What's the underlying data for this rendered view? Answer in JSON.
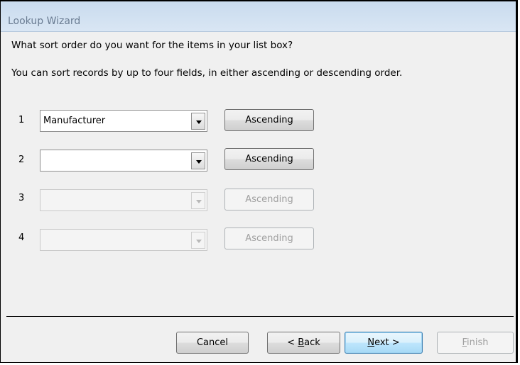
{
  "window": {
    "title": "Lookup Wizard"
  },
  "prompt": {
    "question": "What sort order do you want for the items in your list box?",
    "instructions": "You can sort records by up to four fields, in either ascending or descending order."
  },
  "sort_rows": [
    {
      "number": "1",
      "field": "Manufacturer",
      "order": "Ascending",
      "enabled": true
    },
    {
      "number": "2",
      "field": "",
      "order": "Ascending",
      "enabled": true
    },
    {
      "number": "3",
      "field": "",
      "order": "Ascending",
      "enabled": false
    },
    {
      "number": "4",
      "field": "",
      "order": "Ascending",
      "enabled": false
    }
  ],
  "buttons": {
    "cancel": "Cancel",
    "back_prefix": "< ",
    "back_key": "B",
    "back_rest": "ack",
    "next_key": "N",
    "next_rest": "ext >",
    "finish_key": "F",
    "finish_rest": "inish"
  }
}
